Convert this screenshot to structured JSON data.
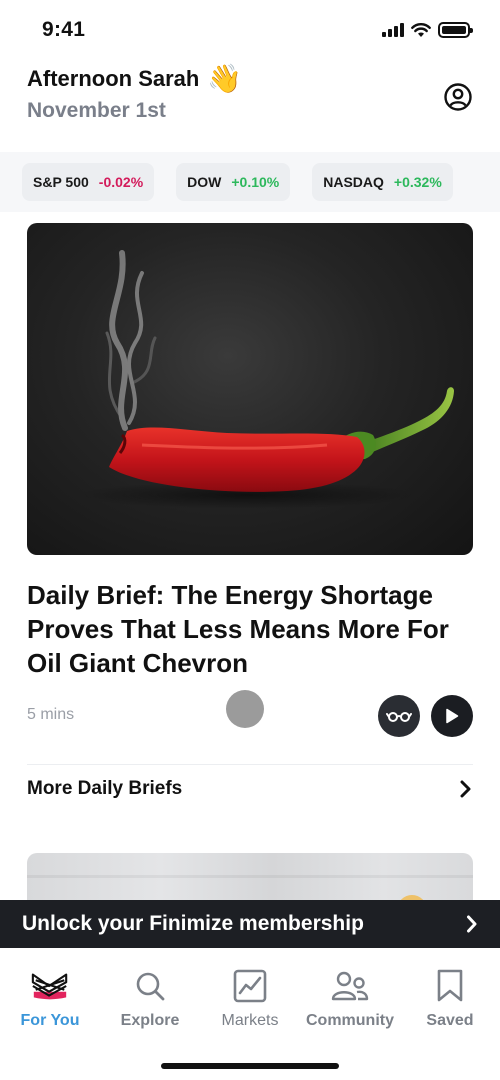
{
  "status": {
    "time": "9:41"
  },
  "header": {
    "greeting": "Afternoon Sarah",
    "wave": "👋",
    "date": "November 1st"
  },
  "tickers": [
    {
      "name": "S&P 500",
      "change": "-0.02%",
      "direction": "down"
    },
    {
      "name": "DOW",
      "change": "+0.10%",
      "direction": "up"
    },
    {
      "name": "NASDAQ",
      "change": "+0.32%",
      "direction": "up"
    }
  ],
  "article": {
    "title": "Daily Brief: The Energy Shortage Proves That Less Means More For Oil Giant Chevron",
    "read_time": "5 mins",
    "image_icon": "smoking-chili-pepper-image"
  },
  "more": {
    "label": "More Daily Briefs"
  },
  "banner": {
    "text": "Unlock your Finimize membership"
  },
  "tabs": [
    {
      "label": "For You",
      "icon": "finimize-logo-icon",
      "active": true
    },
    {
      "label": "Explore",
      "icon": "search-icon",
      "active": false
    },
    {
      "label": "Markets",
      "icon": "chart-icon",
      "active": false
    },
    {
      "label": "Community",
      "icon": "people-icon",
      "active": false
    },
    {
      "label": "Saved",
      "icon": "bookmark-icon",
      "active": false
    }
  ],
  "colors": {
    "negative": "#d31b5b",
    "positive": "#2db85c",
    "active_tab": "#3b96d9",
    "banner": "#1d1f24"
  }
}
